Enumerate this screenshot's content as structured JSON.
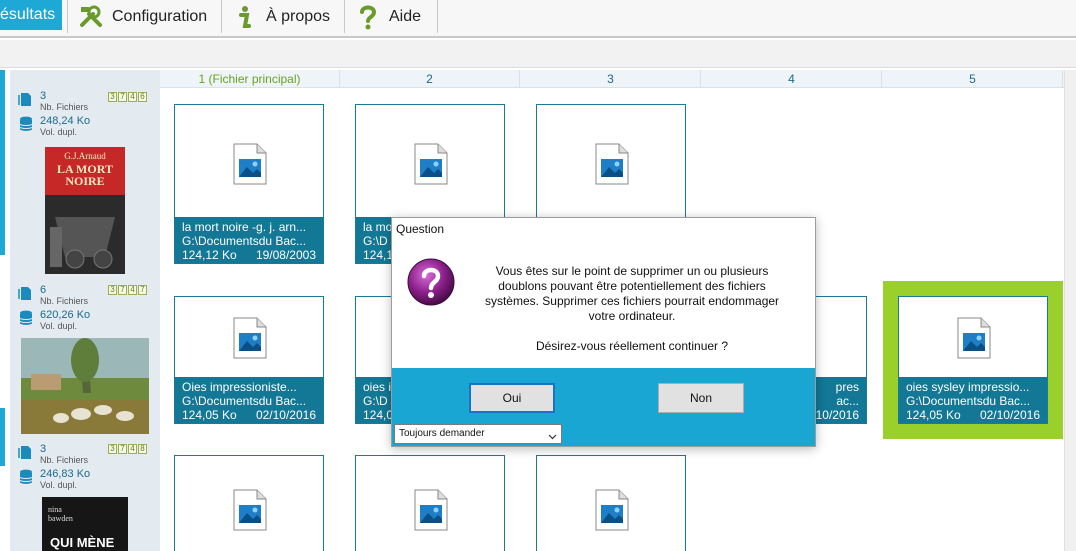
{
  "toolbar": {
    "results_label": "ésultats",
    "config_label": "Configuration",
    "about_label": "À propos",
    "help_label": "Aide"
  },
  "columns": [
    "1 (Fichier principal)",
    "2",
    "3",
    "4",
    "5"
  ],
  "groups": [
    {
      "count": "3",
      "count_label": "Nb. Fichiers",
      "volume": "248,24 Ko",
      "volume_label": "Vol. dupl.",
      "badges": [
        "3",
        "7",
        "4",
        "6"
      ],
      "cover_title": "G.J.Arnaud",
      "cover_sub": "LA MORT\nNOIRE"
    },
    {
      "count": "6",
      "count_label": "Nb. Fichiers",
      "volume": "620,26 Ko",
      "volume_label": "Vol. dupl.",
      "badges": [
        "3",
        "7",
        "4",
        "7"
      ]
    },
    {
      "count": "3",
      "count_label": "Nb. Fichiers",
      "volume": "246,83 Ko",
      "volume_label": "Vol. dupl.",
      "badges": [
        "3",
        "7",
        "4",
        "8"
      ],
      "cover_author": "nina bawden",
      "cover_title": "QUI MÈNE"
    }
  ],
  "cards": {
    "r0c0": {
      "name": "la mort noire -g. j. arn...",
      "path": "G:\\Documentsdu Bac...",
      "size": "124,12 Ko",
      "date": "19/08/2003"
    },
    "r0c1": {
      "name": "la mo",
      "path": "G:\\D",
      "size": "124,1"
    },
    "r1c0": {
      "name": "Oies impressioniste...",
      "path": "G:\\Documentsdu Bac...",
      "size": "124,05 Ko",
      "date": "02/10/2016"
    },
    "r1c1": {
      "name": "oies i",
      "path": "G:\\D",
      "size": "124,0"
    },
    "r1c3": {
      "name": "pres",
      "path": "ac...",
      "date": "10/2016"
    },
    "r1c4": {
      "name": "oies sysley impressio...",
      "path": "G:\\Documentsdu Bac...",
      "size": "124,05 Ko",
      "date": "02/10/2016"
    }
  },
  "dialog": {
    "title": "Question",
    "message_1": "Vous êtes sur le point de supprimer un ou plusieurs doublons pouvant être potentiellement des fichiers systèmes. Supprimer ces fichiers pourrait endommager votre ordinateur.",
    "message_2": "Désirez-vous réellement continuer ?",
    "yes_label": "Oui",
    "no_label": "Non",
    "combo_value": "Toujours demander"
  },
  "colors": {
    "accent": "#1da8d6",
    "card_info": "#127896",
    "selection": "#99d02c",
    "primary_column": "#6aa222"
  }
}
